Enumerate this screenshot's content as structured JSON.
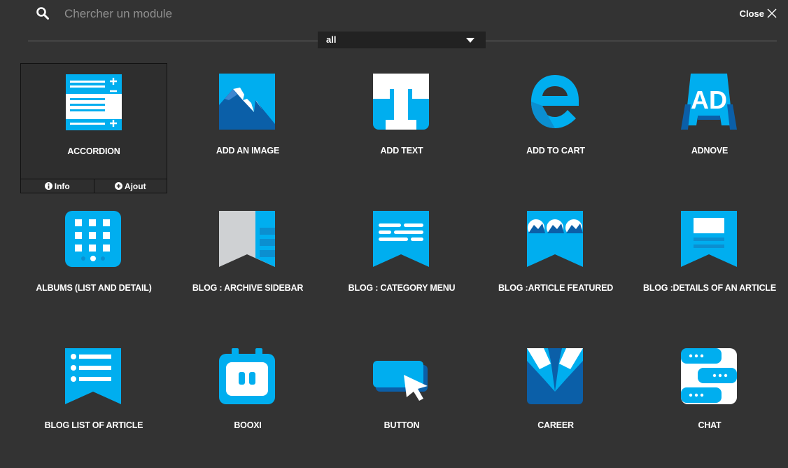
{
  "search": {
    "placeholder": "Chercher un module",
    "icon": "search-icon"
  },
  "header": {
    "close_label": "Close"
  },
  "filter": {
    "selected": "all"
  },
  "colors": {
    "background": "#333333",
    "accent": "#00aeef",
    "accent_dark": "#0b5fa8"
  },
  "tile_actions": {
    "info_label": "Info",
    "add_label": "Ajout"
  },
  "modules": [
    {
      "label": "ACCORDION",
      "icon": "accordion-icon"
    },
    {
      "label": "ADD AN IMAGE",
      "icon": "image-icon"
    },
    {
      "label": "ADD TEXT",
      "icon": "text-icon"
    },
    {
      "label": "ADD TO CART",
      "icon": "cart-icon"
    },
    {
      "label": "ADNOVE",
      "icon": "ad-icon"
    },
    {
      "label": "ALBUMS (LIST AND DETAIL)",
      "icon": "albums-icon"
    },
    {
      "label": "BLOG : ARCHIVE SIDEBAR",
      "icon": "archive-sidebar-icon"
    },
    {
      "label": "BLOG : CATEGORY MENU",
      "icon": "category-menu-icon"
    },
    {
      "label": "BLOG :ARTICLE FEATURED",
      "icon": "article-featured-icon"
    },
    {
      "label": "BLOG :DETAILS OF AN ARTICLE",
      "icon": "article-details-icon"
    },
    {
      "label": "BLOG LIST OF ARTICLE",
      "icon": "article-list-icon"
    },
    {
      "label": "BOOXI",
      "icon": "booxi-icon"
    },
    {
      "label": "BUTTON",
      "icon": "button-icon"
    },
    {
      "label": "CAREER",
      "icon": "career-icon"
    },
    {
      "label": "CHAT",
      "icon": "chat-icon"
    }
  ]
}
